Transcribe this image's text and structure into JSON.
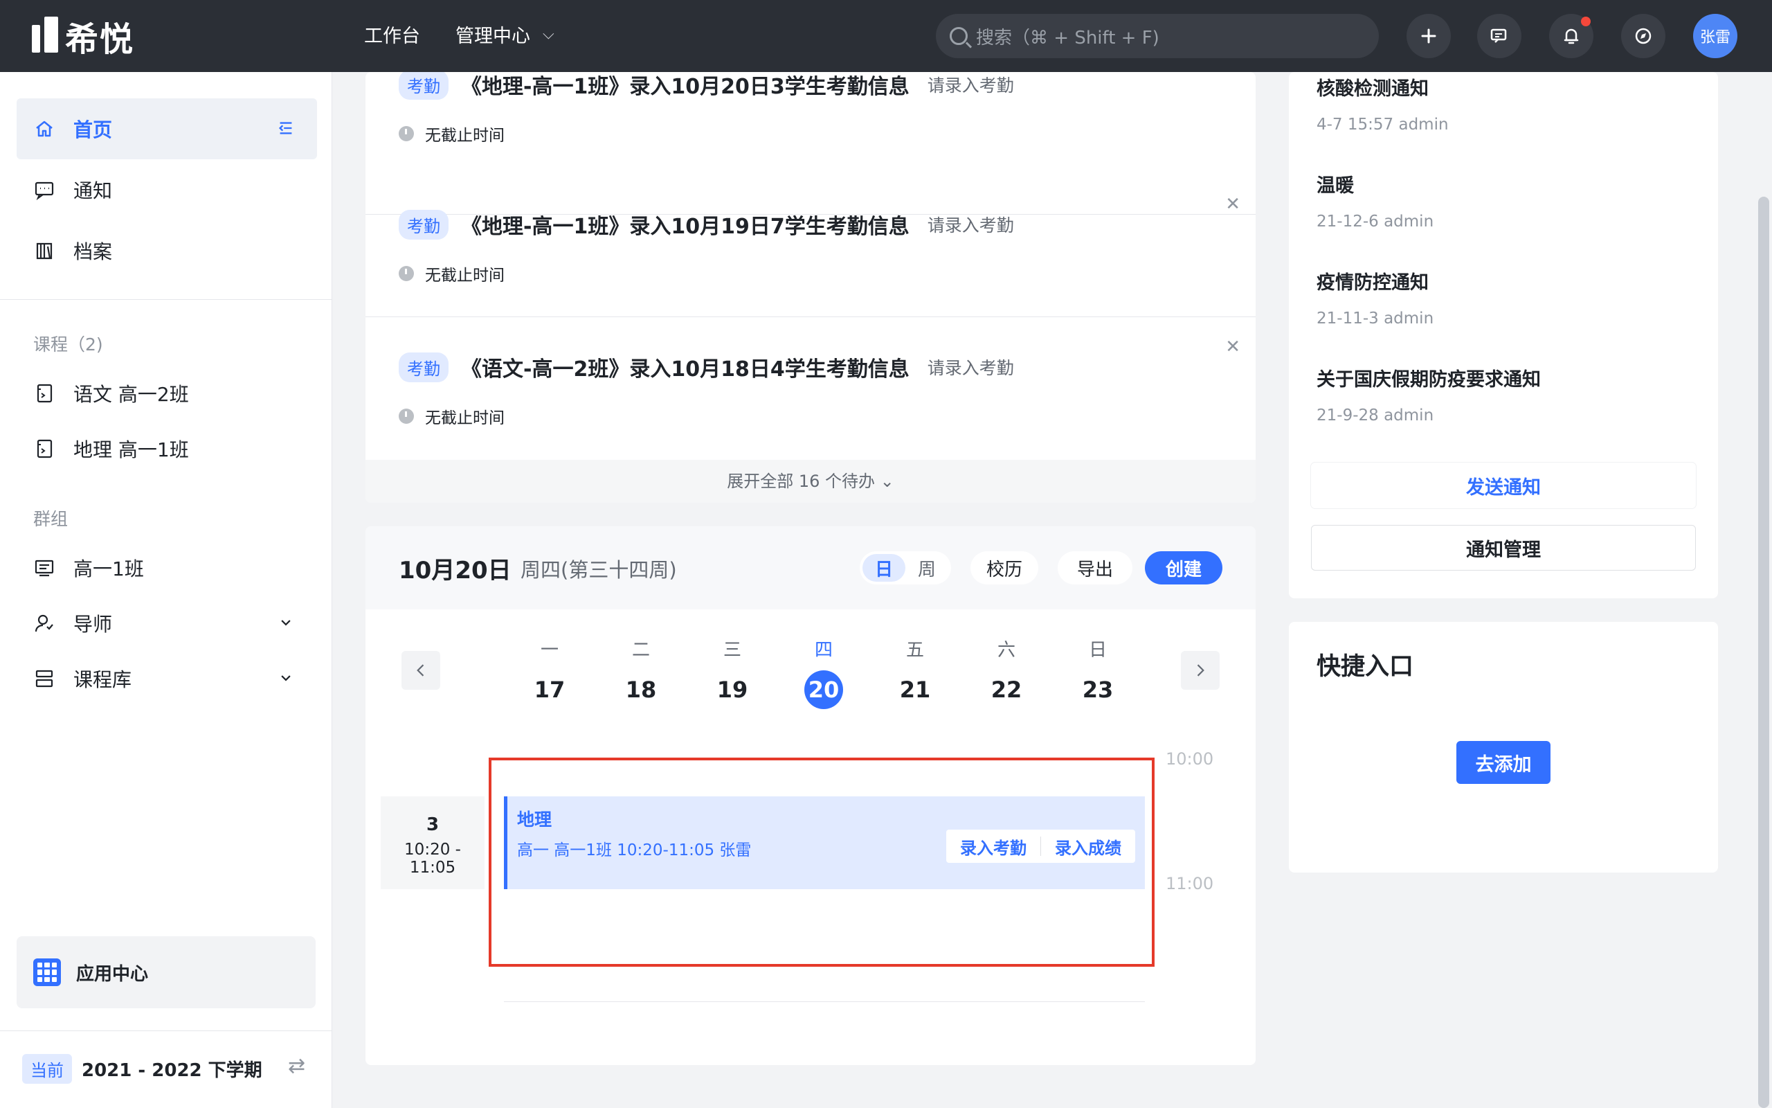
{
  "topbar": {
    "logo_text": "希悦",
    "nav": [
      {
        "label": "工作台"
      },
      {
        "label": "管理中心"
      }
    ],
    "search_placeholder": "搜索（⌘ + Shift + F)",
    "avatar_text": "张雷",
    "icons": [
      "plus-icon",
      "chat-icon",
      "bell-icon",
      "compass-icon"
    ]
  },
  "sidebar": {
    "main_items": [
      {
        "label": "首页",
        "icon": "home-icon"
      },
      {
        "label": "通知",
        "icon": "message-icon"
      },
      {
        "label": "档案",
        "icon": "archive-icon"
      }
    ],
    "courses_header": "课程（2)",
    "courses": [
      {
        "label": "语文 高一2班",
        "icon": "book-icon"
      },
      {
        "label": "地理 高一1班",
        "icon": "book-icon"
      }
    ],
    "groups_header": "群组",
    "groups": [
      {
        "label": "高一1班",
        "icon": "class-icon"
      },
      {
        "label": "导师",
        "icon": "mentor-icon"
      },
      {
        "label": "课程库",
        "icon": "library-icon"
      }
    ],
    "app_center": "应用中心",
    "term_tag": "当前",
    "term_label": "2021 - 2022 下学期"
  },
  "tasks": {
    "items": [
      {
        "badge": "考勤",
        "title": "《地理-高一1班》录入10月20日3学生考勤信息",
        "desc": "请录入考勤",
        "deadline": "无截止时间"
      },
      {
        "badge": "考勤",
        "title": "《地理-高一1班》录入10月19日7学生考勤信息",
        "desc": "请录入考勤",
        "deadline": "无截止时间"
      },
      {
        "badge": "考勤",
        "title": "《语文-高一2班》录入10月18日4学生考勤信息",
        "desc": "请录入考勤",
        "deadline": "无截止时间"
      }
    ],
    "expand_label": "展开全部 16 个待办 ⌄"
  },
  "calendar": {
    "date": "10月20日",
    "week": "周四(第三十四周)",
    "view_day": "日",
    "view_week": "周",
    "school_calendar": "校历",
    "export": "导出",
    "create": "创建",
    "days": [
      {
        "wk": "一",
        "num": "17"
      },
      {
        "wk": "二",
        "num": "18"
      },
      {
        "wk": "三",
        "num": "19"
      },
      {
        "wk": "四",
        "num": "20",
        "today": true
      },
      {
        "wk": "五",
        "num": "21"
      },
      {
        "wk": "六",
        "num": "22"
      },
      {
        "wk": "日",
        "num": "23"
      }
    ],
    "hours": [
      "10:00",
      "11:00"
    ],
    "period": {
      "num": "3",
      "time": "10:20 - 11:05"
    },
    "event": {
      "title": "地理",
      "info": "高一  高一1班  10:20-11:05  张雷",
      "action_attendance": "录入考勤",
      "action_grades": "录入成绩"
    }
  },
  "notices": {
    "items": [
      {
        "title": "核酸检测通知",
        "meta": "4-7 15:57   admin"
      },
      {
        "title": "温暖",
        "meta": "21-12-6   admin"
      },
      {
        "title": "疫情防控通知",
        "meta": "21-11-3   admin"
      },
      {
        "title": "关于国庆假期防疫要求通知",
        "meta": "21-9-28   admin"
      }
    ],
    "send_label": "发送通知",
    "manage_label": "通知管理"
  },
  "quick": {
    "title": "快捷入口",
    "add_label": "去添加"
  },
  "colors": {
    "primary": "#3370ff",
    "topbar": "#2b2f36",
    "highlight": "#e53a2a"
  }
}
